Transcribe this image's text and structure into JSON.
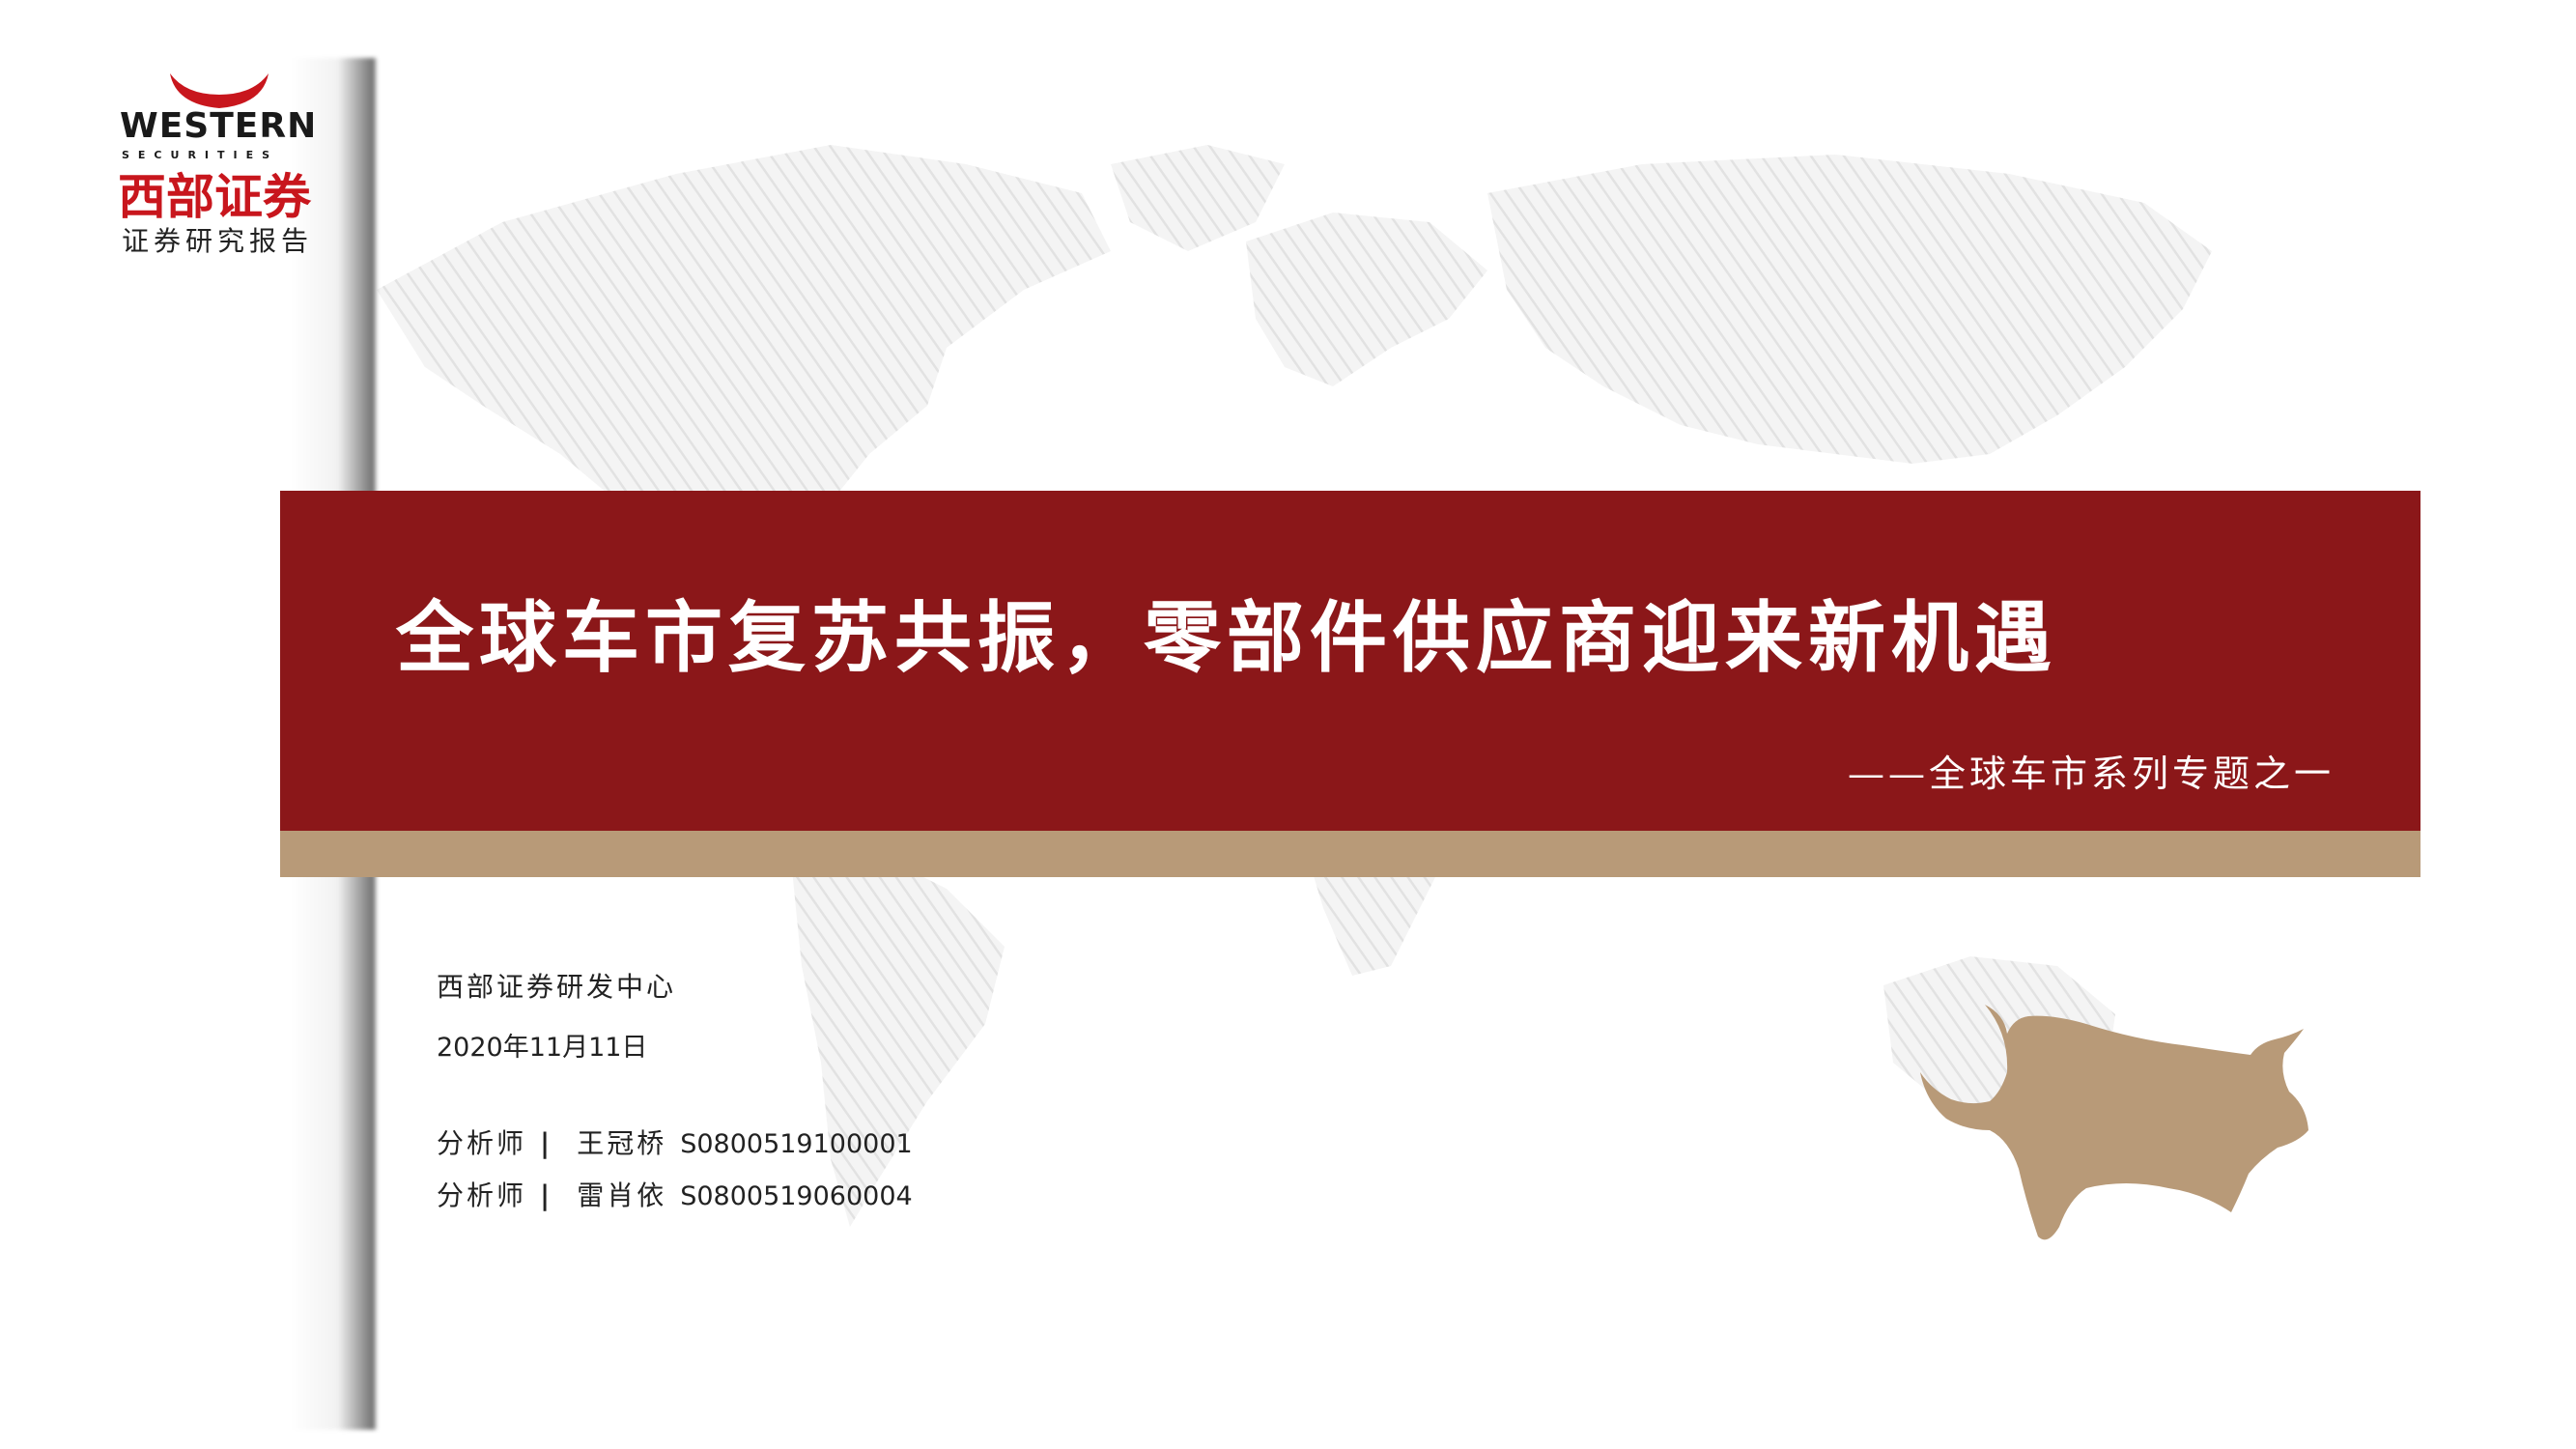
{
  "logo": {
    "en": "WESTERN",
    "sub": "SECURITIES",
    "cn": "西部证券",
    "colors": {
      "red": "#c8161d",
      "dark": "#1a1a1a"
    }
  },
  "report_type": "证券研究报告",
  "banner": {
    "title": "全球车市复苏共振，零部件供应商迎来新机遇",
    "subtitle": "——全球车市系列专题之一",
    "colors": {
      "main": "#8b1719",
      "stripe": "#b89a78"
    }
  },
  "info": {
    "center": "西部证券研发中心",
    "date": "2020年11月11日",
    "analysts": [
      {
        "role": "分析师",
        "separator": "|",
        "name": "王冠桥",
        "id": "S0800519100001"
      },
      {
        "role": "分析师",
        "separator": "|",
        "name": "雷肖依",
        "id": "S0800519060004"
      }
    ]
  },
  "decor": {
    "world_map": "world-map-watermark",
    "bull": "bull-icon",
    "bull_color": "#b89a78"
  }
}
